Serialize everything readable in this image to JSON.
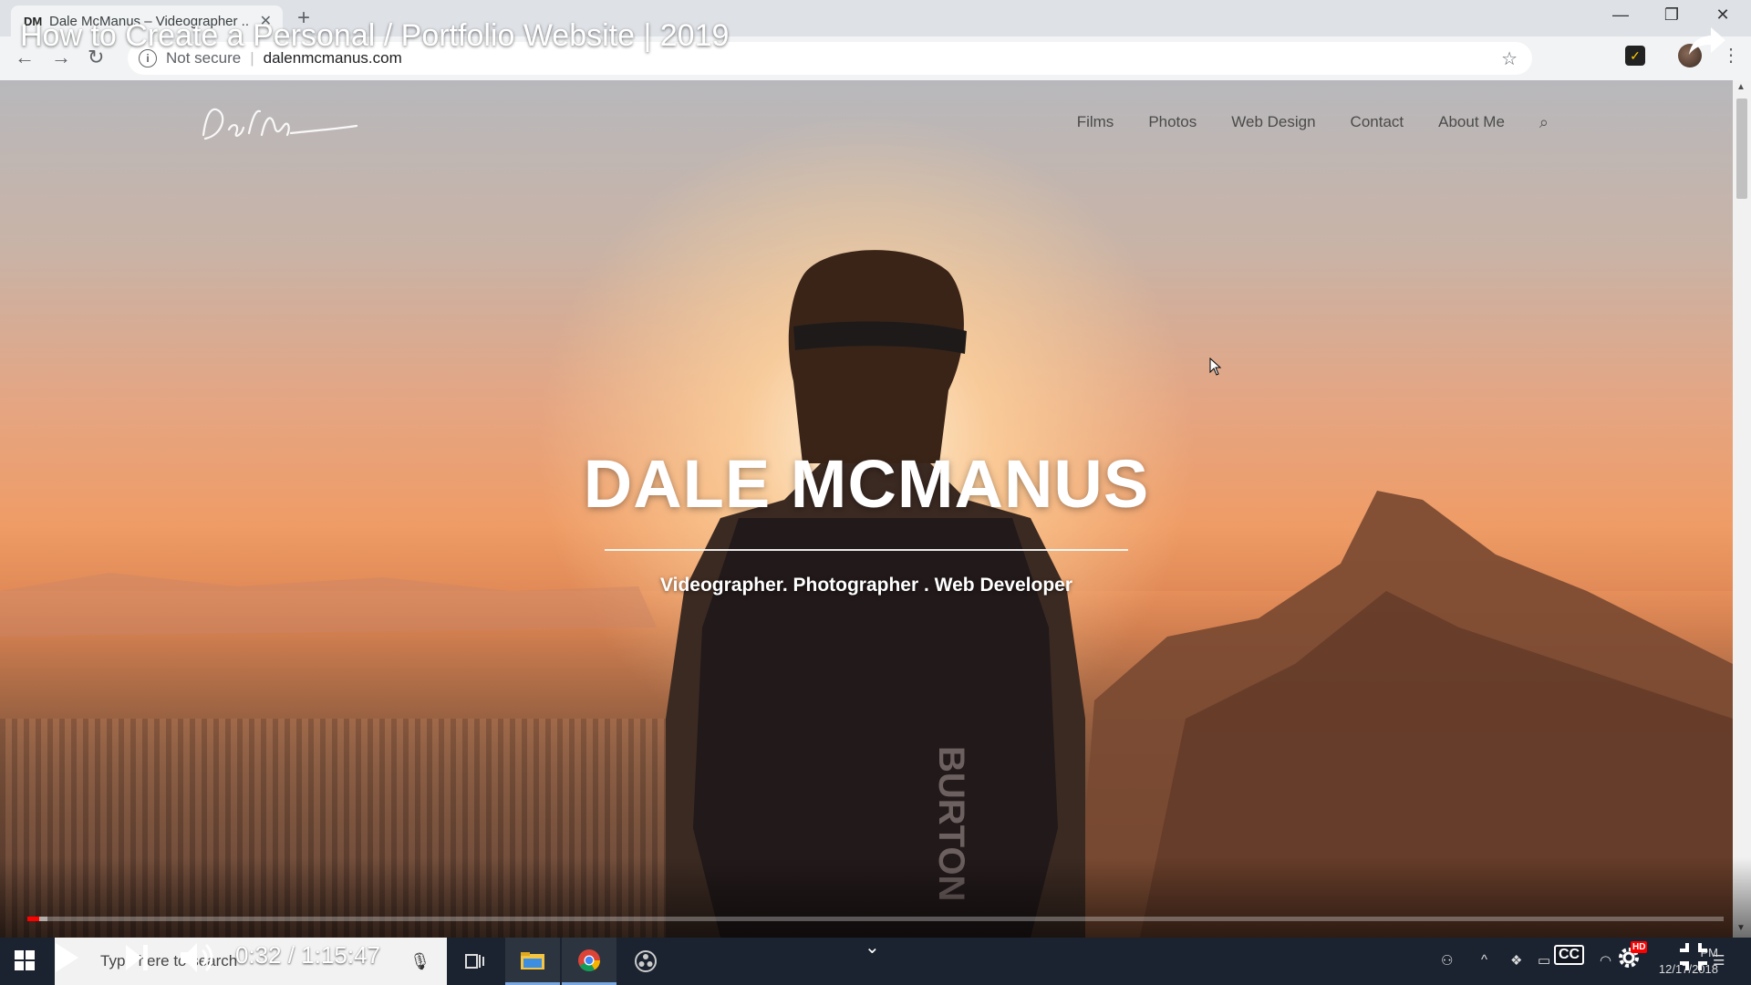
{
  "browser": {
    "tab_favicon": "DM",
    "tab_title": "Dale McManus – Videographer ...",
    "tab_close": "✕",
    "new_tab": "+",
    "window_minimize": "—",
    "window_restore": "❐",
    "window_close": "✕",
    "info_icon": "i",
    "not_secure": "Not secure",
    "separator": "|",
    "url": "dalenmcmanus.com",
    "star": "☆",
    "menu": "⋮",
    "back": "←",
    "forward": "→",
    "reload": "↻"
  },
  "site": {
    "nav": [
      "Films",
      "Photos",
      "Web Design",
      "Contact",
      "About Me"
    ],
    "search_icon": "⌕",
    "hero_title": "DALE MCMANUS",
    "hero_subtitle": "Videographer. Photographer . Web Developer"
  },
  "youtube": {
    "video_title": "How to Create a Personal / Portfolio Website | 2019",
    "time_current": "0:32",
    "time_total": "1:15:47",
    "time_sep": " / ",
    "progress_played": 0.007,
    "progress_loaded": 0.012,
    "cc_label": "CC",
    "hd_label": "HD",
    "chevron": "⌄"
  },
  "taskbar": {
    "search_placeholder": "Type here to search",
    "mic": "🎙",
    "clock_time": "PM",
    "clock_date": "12/17/2018"
  },
  "colors": {
    "accent_red": "#ff0000",
    "taskbar_bg": "#1b2330",
    "chrome_bg": "#dee1e6"
  }
}
